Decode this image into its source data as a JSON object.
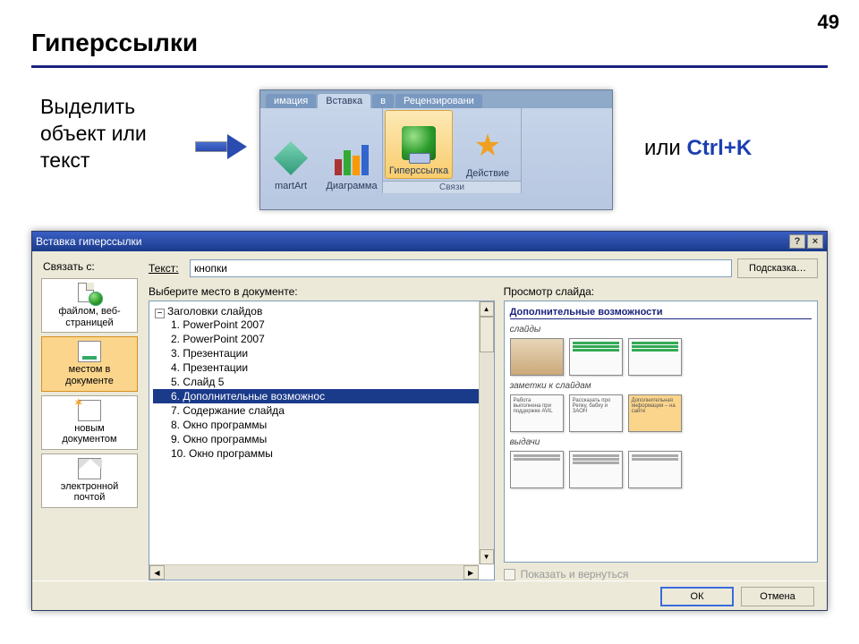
{
  "page_number": "49",
  "title": "Гиперссылки",
  "instruction": "Выделить\nобъект или\nтекст",
  "ili": "или ",
  "ctrlk": "Ctrl+K",
  "ribbon": {
    "tabs": [
      "имация",
      "Вставка",
      "в",
      "Рецензировани"
    ],
    "active_tab_index": 1,
    "items": {
      "smartart": "martArt",
      "chart": "Диаграмма",
      "hyperlink": "Гиперссылка",
      "action": "Действие"
    },
    "group_label": "Связи"
  },
  "dialog": {
    "title": "Вставка гиперссылки",
    "help_btn": "?",
    "close_btn": "×",
    "sidebar_label": "Связать с:",
    "options": [
      {
        "label": "файлом, веб-\nстраницей",
        "icon": "file-web"
      },
      {
        "label": "местом в\nдокументе",
        "icon": "doc-place",
        "selected": true
      },
      {
        "label": "новым\nдокументом",
        "icon": "new-doc"
      },
      {
        "label": "электронной\nпочтой",
        "icon": "email"
      }
    ],
    "text_label": "Текст:",
    "text_value": "кнопки",
    "hint_btn": "Подсказка…",
    "tree_label": "Выберите место в документе:",
    "tree_root": "Заголовки слайдов",
    "tree_items": [
      "1. PowerPoint 2007",
      "2. PowerPoint 2007",
      "3. Презентации",
      "4. Презентации",
      "5. Слайд 5",
      "6. Дополнительные возможнос",
      "7. Содержание слайда",
      "8. Окно программы",
      "9. Окно программы",
      "10. Окно программы"
    ],
    "tree_selected_index": 5,
    "preview_label": "Просмотр слайда:",
    "preview_title": "Дополнительные возможности",
    "preview_sections": [
      "слайды",
      "заметки к слайдам",
      "выдачи"
    ],
    "preview_caption1": "Работа\nвыполнена при\nподдержке AViL",
    "preview_caption2": "Рассказать про\nРепку, бабку и\nЗАОН",
    "preview_caption3": "Дополнительная\nинформация – на\nсайте",
    "show_return": "Показать и вернуться",
    "ok": "ОК",
    "cancel": "Отмена"
  }
}
